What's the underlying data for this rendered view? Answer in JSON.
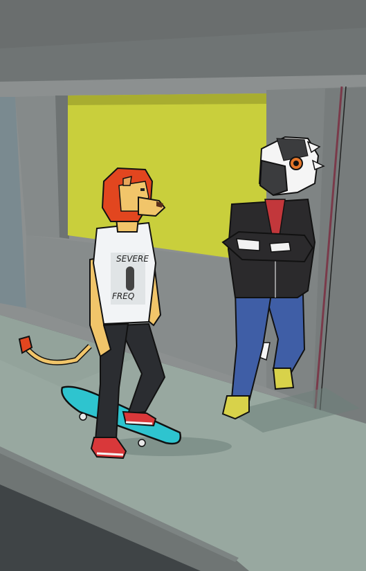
{
  "scene": {
    "description_free": true,
    "palette": {
      "wall": "#8c9090",
      "wall_shadow": "#6f7474",
      "ceiling": "#6a6e6e",
      "window_panel": "#c9cf3c",
      "sidewalk": "#98a8a0",
      "curb": "#6f7574",
      "street": "#3f4446",
      "lion_fur": "#f1c56a",
      "lion_mane": "#e2461f",
      "shirt": "#f2f4f6",
      "jeans_dark": "#2b2d31",
      "sneakers": "#d9383a",
      "skateboard": "#2ec4cf",
      "jacket": "#2b2a2c",
      "jeans_blue": "#3f5ea6",
      "hoodie_red": "#c2373b",
      "bird_mask_white": "#f5f5f5",
      "bird_mask_grey": "#3b3c3e",
      "bird_eye": "#e3752a",
      "shoes_yellow": "#d8d24a"
    },
    "shirt_print": {
      "line1": "SEVERE",
      "line2": "FREQ"
    }
  }
}
